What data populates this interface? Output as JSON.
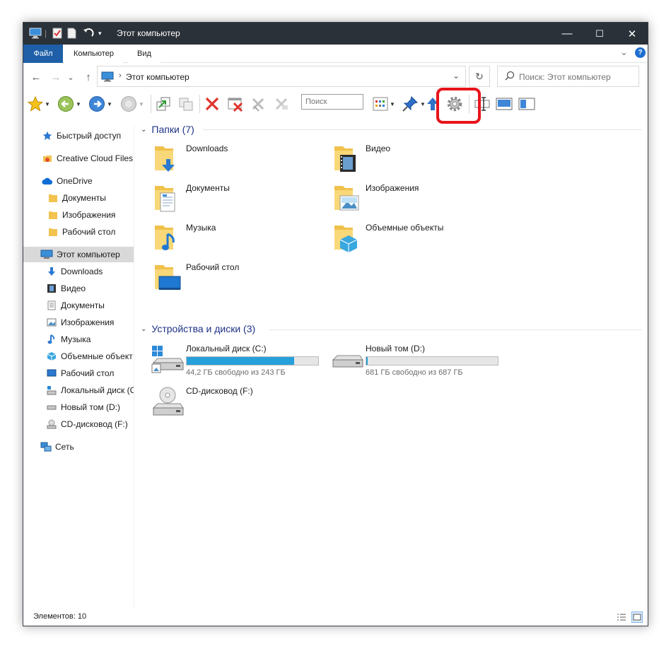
{
  "window": {
    "title": "Этот компьютер",
    "minimize_glyph": "—",
    "maximize_glyph": "☐",
    "close_glyph": "✕"
  },
  "ribbon": {
    "tabs": [
      {
        "label": "Файл"
      },
      {
        "label": "Компьютер"
      },
      {
        "label": "Вид"
      }
    ],
    "expand_glyph": "⌄",
    "help_glyph": "?"
  },
  "address": {
    "back_glyph": "←",
    "forward_glyph": "→",
    "recent_glyph": "⌄",
    "up_glyph": "↑",
    "separator": "›",
    "path": "Этот компьютер",
    "dropdown_glyph": "⌄",
    "refresh_glyph": "↻",
    "search_placeholder": "Поиск: Этот компьютер"
  },
  "toolbar": {
    "search_placeholder": "Поиск",
    "highlight_color": "#e8141b"
  },
  "nav": {
    "items": [
      {
        "label": "Быстрый доступ",
        "icon": "star-icon"
      },
      {
        "label": "Creative Cloud Files",
        "icon": "creative-cloud-icon"
      },
      {
        "label": "OneDrive",
        "icon": "cloud-icon"
      },
      {
        "label": "Документы",
        "icon": "folder-icon"
      },
      {
        "label": "Изображения",
        "icon": "folder-icon"
      },
      {
        "label": "Рабочий стол",
        "icon": "folder-icon"
      },
      {
        "label": "Этот компьютер",
        "icon": "computer-icon"
      },
      {
        "label": "Downloads",
        "icon": "download-icon"
      },
      {
        "label": "Видео",
        "icon": "video-icon"
      },
      {
        "label": "Документы",
        "icon": "document-icon"
      },
      {
        "label": "Изображения",
        "icon": "picture-icon"
      },
      {
        "label": "Музыка",
        "icon": "music-icon"
      },
      {
        "label": "Объемные объект",
        "icon": "3d-objects-icon"
      },
      {
        "label": "Рабочий стол",
        "icon": "desktop-icon"
      },
      {
        "label": "Локальный диск (C",
        "icon": "system-drive-icon"
      },
      {
        "label": "Новый том (D:)",
        "icon": "drive-icon"
      },
      {
        "label": "CD-дисковод (F:)",
        "icon": "cd-drive-icon"
      },
      {
        "label": "Сеть",
        "icon": "network-icon"
      }
    ]
  },
  "content": {
    "folders_header": "Папки (7)",
    "drives_header": "Устройства и диски (3)",
    "folders": [
      {
        "name": "Downloads",
        "icon": "downloads-folder-icon"
      },
      {
        "name": "Видео",
        "icon": "videos-folder-icon"
      },
      {
        "name": "Документы",
        "icon": "documents-folder-icon"
      },
      {
        "name": "Изображения",
        "icon": "pictures-folder-icon"
      },
      {
        "name": "Музыка",
        "icon": "music-folder-icon"
      },
      {
        "name": "Объемные объекты",
        "icon": "3d-objects-folder-icon"
      },
      {
        "name": "Рабочий стол",
        "icon": "desktop-folder-icon"
      }
    ],
    "drives": [
      {
        "name": "Локальный диск (C:)",
        "free": "44,2 ГБ свободно из 243 ГБ",
        "used_fraction": 0.818,
        "icon": "system-drive-icon"
      },
      {
        "name": "Новый том (D:)",
        "free": "681 ГБ свободно из 687 ГБ",
        "used_fraction": 0.009,
        "icon": "drive-icon"
      },
      {
        "name": "CD-дисковод (F:)",
        "icon": "cd-drive-icon"
      }
    ],
    "bar_color": "#26a0da"
  },
  "status": {
    "count": "Элементов: 10"
  }
}
